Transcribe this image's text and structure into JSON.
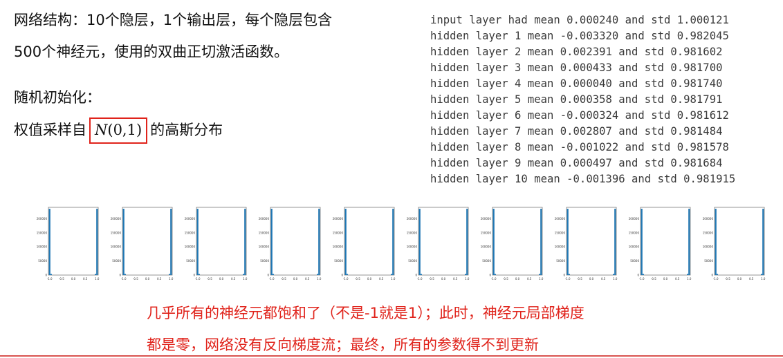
{
  "structure": {
    "line1": "网络结构：10个隐层，1个输出层，每个隐层包含",
    "line2": "500个神经元，使用的双曲正切激活函数。"
  },
  "init": {
    "heading": "随机初始化：",
    "prefix": "权值采样自",
    "formula_var": "N",
    "formula_args": "(0,1)",
    "suffix": "的高斯分布"
  },
  "log_lines": [
    "input layer had mean 0.000240 and std 1.000121",
    "hidden layer 1 mean -0.003320 and std 0.982045",
    "hidden layer 2 mean 0.002391 and std 0.981602",
    "hidden layer 3 mean 0.000433 and std 0.981700",
    "hidden layer 4 mean 0.000040 and std 0.981740",
    "hidden layer 5 mean 0.000358 and std 0.981791",
    "hidden layer 6 mean -0.000324 and std 0.981612",
    "hidden layer 7 mean 0.002807 and std 0.981484",
    "hidden layer 8 mean -0.001022 and std 0.981578",
    "hidden layer 9 mean 0.000497 and std 0.981684",
    "hidden layer 10 mean -0.001396 and std 0.981915"
  ],
  "histograms": {
    "count": 10,
    "bar_color": "#1f77b4",
    "y_ticks": [
      "200000",
      "150000",
      "100000",
      "50000",
      "0"
    ],
    "y_tick_values": [
      200000,
      150000,
      100000,
      50000,
      0
    ],
    "y_max": 240000,
    "x_ticks": [
      "-1.0",
      "-0.5",
      "0.0",
      "0.5",
      "1.0"
    ],
    "x_tick_values": [
      -1.0,
      -0.5,
      0.0,
      0.5,
      1.0
    ],
    "x_range": [
      -1.05,
      1.05
    ],
    "peak_positions": [
      -1.0,
      1.0
    ],
    "peak_count": 235000,
    "near_peak_count": 4000
  },
  "summary": {
    "line1": "几乎所有的神经元都饱和了（不是-1就是1）；此时，神经元局部梯度",
    "line2": "都是零，网络没有反向梯度流；最终，所有的参数得不到更新"
  },
  "colors": {
    "accent_red": "#e0231b",
    "log_text": "#3a3a3a",
    "rule": "#d9534f"
  }
}
